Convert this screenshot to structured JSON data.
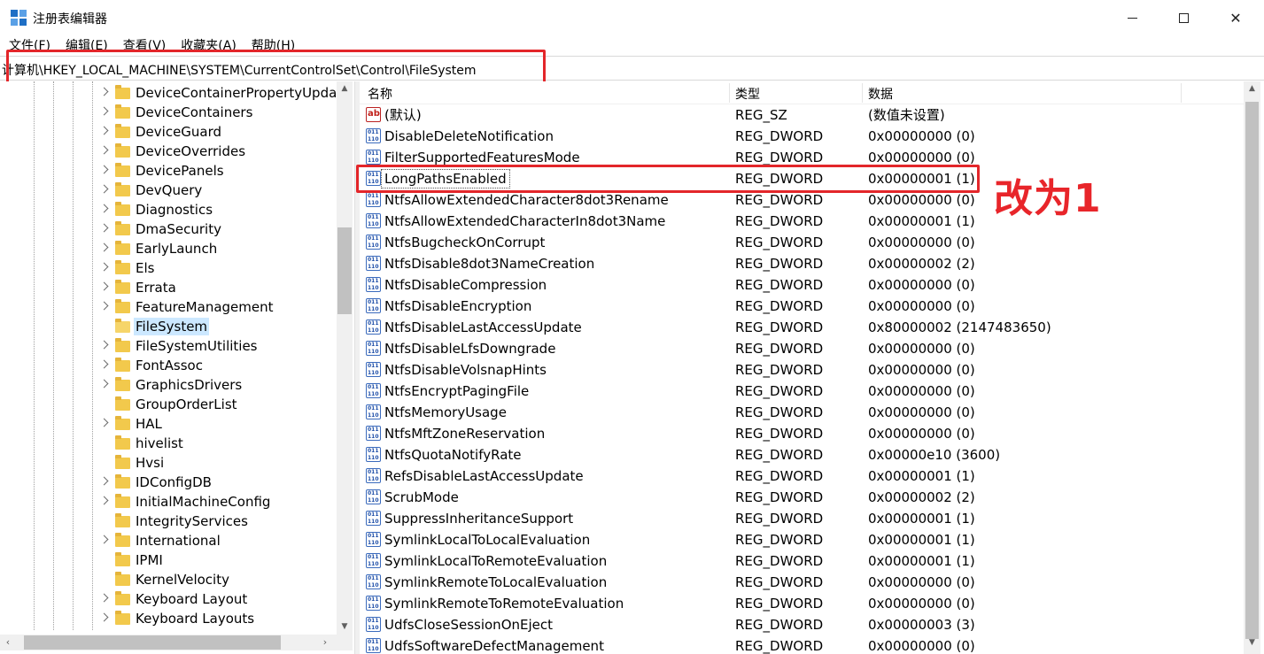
{
  "window": {
    "title": "注册表编辑器",
    "minimize": "—",
    "close": "✕"
  },
  "menu": [
    "文件(F)",
    "编辑(E)",
    "查看(V)",
    "收藏夹(A)",
    "帮助(H)"
  ],
  "address": "计算机\\HKEY_LOCAL_MACHINE\\SYSTEM\\CurrentControlSet\\Control\\FileSystem",
  "tree": {
    "items": [
      {
        "label": "DeviceContainerPropertyUpda",
        "expandable": true
      },
      {
        "label": "DeviceContainers",
        "expandable": true
      },
      {
        "label": "DeviceGuard",
        "expandable": true
      },
      {
        "label": "DeviceOverrides",
        "expandable": true
      },
      {
        "label": "DevicePanels",
        "expandable": true
      },
      {
        "label": "DevQuery",
        "expandable": true
      },
      {
        "label": "Diagnostics",
        "expandable": true
      },
      {
        "label": "DmaSecurity",
        "expandable": true
      },
      {
        "label": "EarlyLaunch",
        "expandable": true
      },
      {
        "label": "Els",
        "expandable": true
      },
      {
        "label": "Errata",
        "expandable": true
      },
      {
        "label": "FeatureManagement",
        "expandable": true
      },
      {
        "label": "FileSystem",
        "expandable": false,
        "selected": true
      },
      {
        "label": "FileSystemUtilities",
        "expandable": true
      },
      {
        "label": "FontAssoc",
        "expandable": true
      },
      {
        "label": "GraphicsDrivers",
        "expandable": true
      },
      {
        "label": "GroupOrderList",
        "expandable": false
      },
      {
        "label": "HAL",
        "expandable": true
      },
      {
        "label": "hivelist",
        "expandable": false
      },
      {
        "label": "Hvsi",
        "expandable": false
      },
      {
        "label": "IDConfigDB",
        "expandable": true
      },
      {
        "label": "InitialMachineConfig",
        "expandable": true
      },
      {
        "label": "IntegrityServices",
        "expandable": false
      },
      {
        "label": "International",
        "expandable": true
      },
      {
        "label": "IPMI",
        "expandable": false
      },
      {
        "label": "KernelVelocity",
        "expandable": false
      },
      {
        "label": "Keyboard Layout",
        "expandable": true
      },
      {
        "label": "Keyboard Layouts",
        "expandable": true
      }
    ]
  },
  "list": {
    "headers": {
      "name": "名称",
      "type": "类型",
      "data": "数据"
    },
    "rows": [
      {
        "icon": "string-value-icon",
        "name": "(默认)",
        "type": "REG_SZ",
        "data": "(数值未设置)"
      },
      {
        "icon": "dword-value-icon",
        "name": "DisableDeleteNotification",
        "type": "REG_DWORD",
        "data": "0x00000000 (0)"
      },
      {
        "icon": "dword-value-icon",
        "name": "FilterSupportedFeaturesMode",
        "type": "REG_DWORD",
        "data": "0x00000000 (0)"
      },
      {
        "icon": "dword-value-icon",
        "name": "LongPathsEnabled",
        "type": "REG_DWORD",
        "data": "0x00000001 (1)",
        "focused": true
      },
      {
        "icon": "dword-value-icon",
        "name": "NtfsAllowExtendedCharacter8dot3Rename",
        "type": "REG_DWORD",
        "data": "0x00000000 (0)"
      },
      {
        "icon": "dword-value-icon",
        "name": "NtfsAllowExtendedCharacterIn8dot3Name",
        "type": "REG_DWORD",
        "data": "0x00000001 (1)"
      },
      {
        "icon": "dword-value-icon",
        "name": "NtfsBugcheckOnCorrupt",
        "type": "REG_DWORD",
        "data": "0x00000000 (0)"
      },
      {
        "icon": "dword-value-icon",
        "name": "NtfsDisable8dot3NameCreation",
        "type": "REG_DWORD",
        "data": "0x00000002 (2)"
      },
      {
        "icon": "dword-value-icon",
        "name": "NtfsDisableCompression",
        "type": "REG_DWORD",
        "data": "0x00000000 (0)"
      },
      {
        "icon": "dword-value-icon",
        "name": "NtfsDisableEncryption",
        "type": "REG_DWORD",
        "data": "0x00000000 (0)"
      },
      {
        "icon": "dword-value-icon",
        "name": "NtfsDisableLastAccessUpdate",
        "type": "REG_DWORD",
        "data": "0x80000002 (2147483650)"
      },
      {
        "icon": "dword-value-icon",
        "name": "NtfsDisableLfsDowngrade",
        "type": "REG_DWORD",
        "data": "0x00000000 (0)"
      },
      {
        "icon": "dword-value-icon",
        "name": "NtfsDisableVolsnapHints",
        "type": "REG_DWORD",
        "data": "0x00000000 (0)"
      },
      {
        "icon": "dword-value-icon",
        "name": "NtfsEncryptPagingFile",
        "type": "REG_DWORD",
        "data": "0x00000000 (0)"
      },
      {
        "icon": "dword-value-icon",
        "name": "NtfsMemoryUsage",
        "type": "REG_DWORD",
        "data": "0x00000000 (0)"
      },
      {
        "icon": "dword-value-icon",
        "name": "NtfsMftZoneReservation",
        "type": "REG_DWORD",
        "data": "0x00000000 (0)"
      },
      {
        "icon": "dword-value-icon",
        "name": "NtfsQuotaNotifyRate",
        "type": "REG_DWORD",
        "data": "0x00000e10 (3600)"
      },
      {
        "icon": "dword-value-icon",
        "name": "RefsDisableLastAccessUpdate",
        "type": "REG_DWORD",
        "data": "0x00000001 (1)"
      },
      {
        "icon": "dword-value-icon",
        "name": "ScrubMode",
        "type": "REG_DWORD",
        "data": "0x00000002 (2)"
      },
      {
        "icon": "dword-value-icon",
        "name": "SuppressInheritanceSupport",
        "type": "REG_DWORD",
        "data": "0x00000001 (1)"
      },
      {
        "icon": "dword-value-icon",
        "name": "SymlinkLocalToLocalEvaluation",
        "type": "REG_DWORD",
        "data": "0x00000001 (1)"
      },
      {
        "icon": "dword-value-icon",
        "name": "SymlinkLocalToRemoteEvaluation",
        "type": "REG_DWORD",
        "data": "0x00000001 (1)"
      },
      {
        "icon": "dword-value-icon",
        "name": "SymlinkRemoteToLocalEvaluation",
        "type": "REG_DWORD",
        "data": "0x00000000 (0)"
      },
      {
        "icon": "dword-value-icon",
        "name": "SymlinkRemoteToRemoteEvaluation",
        "type": "REG_DWORD",
        "data": "0x00000000 (0)"
      },
      {
        "icon": "dword-value-icon",
        "name": "UdfsCloseSessionOnEject",
        "type": "REG_DWORD",
        "data": "0x00000003 (3)"
      },
      {
        "icon": "dword-value-icon",
        "name": "UdfsSoftwareDefectManagement",
        "type": "REG_DWORD",
        "data": "0x00000000 (0)"
      }
    ]
  },
  "annotation": {
    "text": "改为1",
    "color": "#e8252a"
  },
  "colors": {
    "highlight": "#e3262a",
    "selection": "#cce8ff",
    "folder": "#f2c94c"
  }
}
